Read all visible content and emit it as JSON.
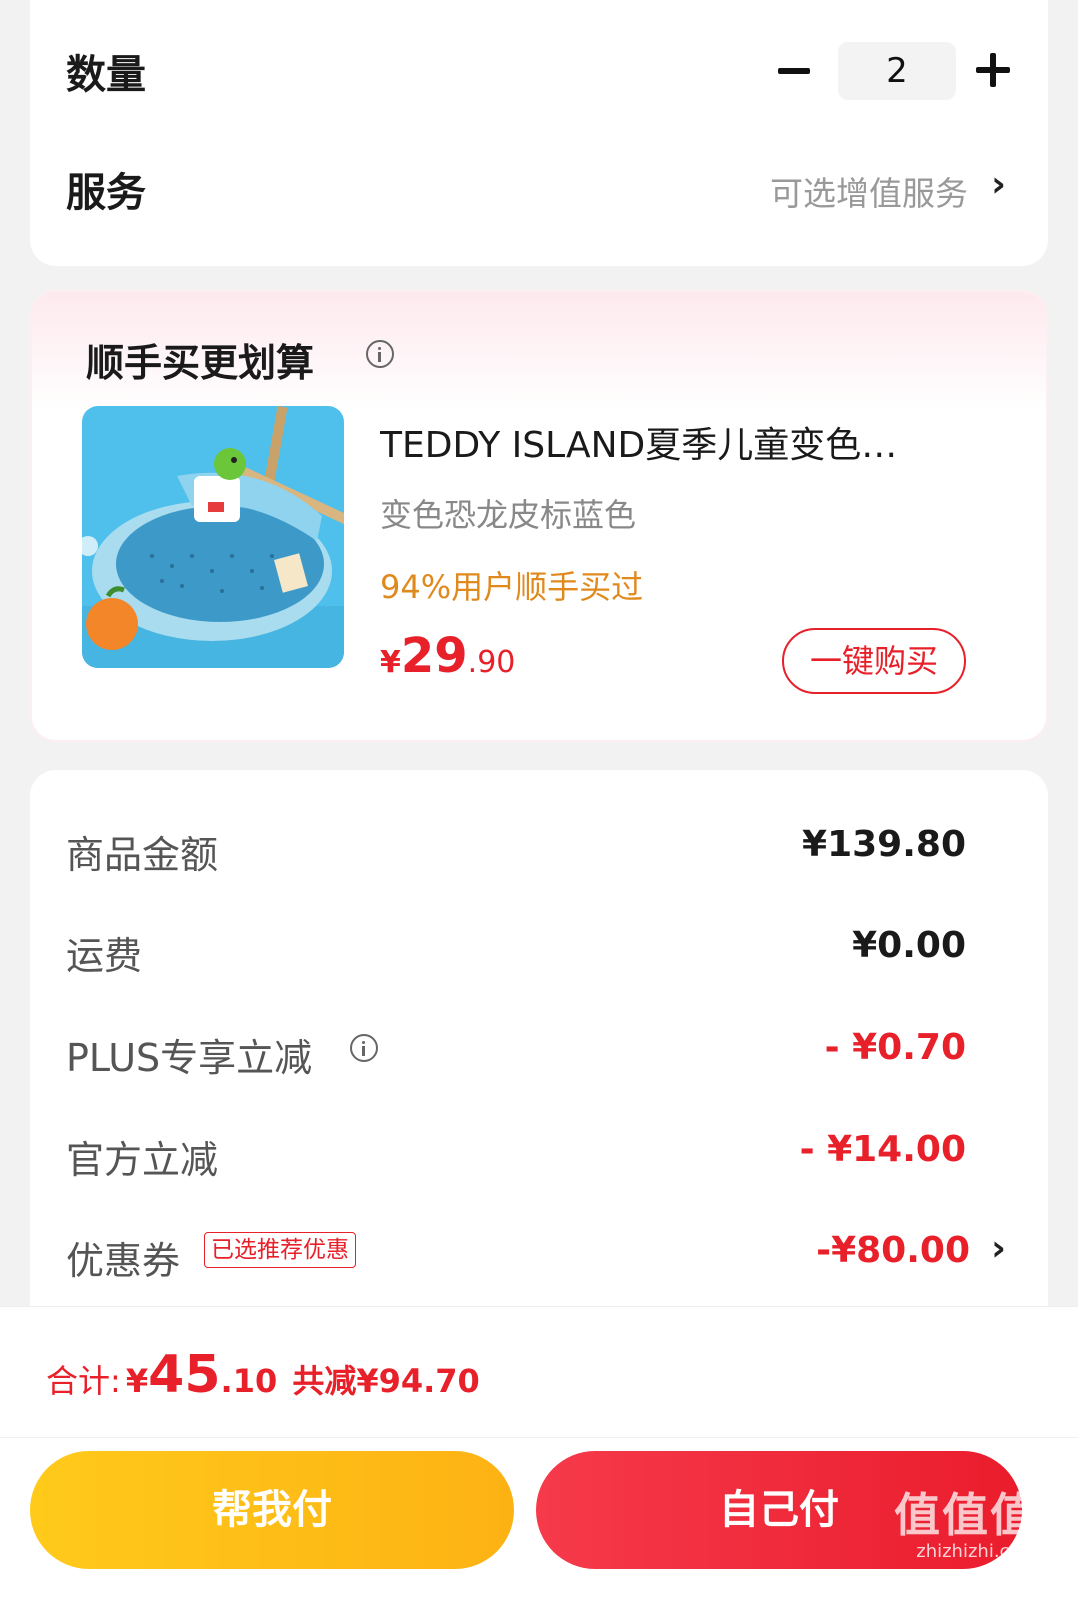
{
  "options": {
    "quantity_label": "数量",
    "quantity_value": "2",
    "service_label": "服务",
    "service_value": "可选增值服务"
  },
  "recommend": {
    "title": "顺手买更划算",
    "product": {
      "name": "TEDDY ISLAND夏季儿童变色…",
      "variant": "变色恐龙皮标蓝色",
      "social_proof": "94%用户顺手买过",
      "price_symbol": "¥",
      "price_int": "29",
      "price_dec": ".90",
      "buy_label": "一键购买"
    }
  },
  "summary": {
    "rows": [
      {
        "label": "商品金额",
        "value": "¥139.80"
      },
      {
        "label": "运费",
        "value": "¥0.00"
      },
      {
        "label": "PLUS专享立减",
        "value": "- ¥0.70"
      },
      {
        "label": "官方立减",
        "value": "- ¥14.00"
      },
      {
        "label": "优惠券",
        "value": "-¥80.00",
        "badge": "已选推荐优惠"
      }
    ]
  },
  "footer": {
    "total_label": "合计:",
    "total_symbol": "¥",
    "total_int": "45",
    "total_dec": ".10",
    "saved": "共减¥94.70",
    "help_pay": "帮我付",
    "self_pay": "自己付",
    "watermark": "值值值",
    "watermark_site": "zhizhizhi.com"
  },
  "colors": {
    "accent_red": "#e8202a",
    "accent_yellow": "#fdb214",
    "social_orange": "#e08a1e"
  }
}
